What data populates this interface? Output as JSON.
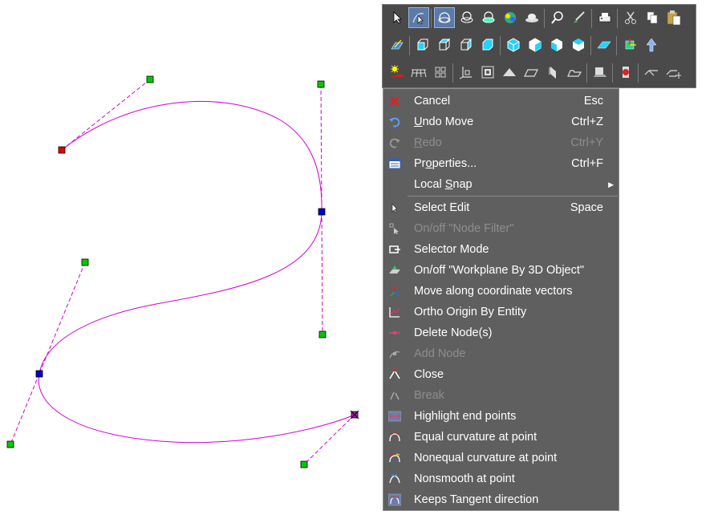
{
  "toolbar": {
    "row1": [
      "select-arrow",
      "edit-node",
      "sphere-tool",
      "cylinder-tool",
      "sphere-alt-tool",
      "color-tool",
      "hat-tool",
      "zoom-search",
      "brush-tool",
      "printer-tool",
      "cut",
      "copy",
      "paste"
    ],
    "row2": [
      "workplane-tool",
      "box-front",
      "box-top",
      "box-side",
      "box-iso",
      "cube-1",
      "cube-2",
      "cube-3",
      "cube-4",
      "plane-tool",
      "coordinate-tool",
      "up-arrow-tool"
    ],
    "row3": [
      "light-tool",
      "grid-tool",
      "small-grid-tool",
      "axis-tool",
      "frame-tool",
      "plane-a",
      "plane-b",
      "book-tool",
      "folder-tool",
      "stamp-tool",
      "red-item-tool",
      "angle-a",
      "angle-b"
    ]
  },
  "menu": {
    "items": [
      {
        "label": "Cancel",
        "shortcut": "Esc",
        "icon": "cancel-icon",
        "disabled": false
      },
      {
        "label": "Undo Move",
        "ul": 0,
        "shortcut": "Ctrl+Z",
        "icon": "undo-icon",
        "disabled": false
      },
      {
        "label": "Redo",
        "ul": 0,
        "shortcut": "Ctrl+Y",
        "icon": "redo-icon",
        "disabled": true
      },
      {
        "label": "Properties...",
        "ul": 2,
        "shortcut": "Ctrl+F",
        "icon": "properties-icon",
        "disabled": false
      },
      {
        "label": "Local Snap",
        "ul": 6,
        "shortcut": "",
        "icon": "",
        "disabled": false,
        "submenu": true
      },
      {
        "label": "Select Edit",
        "shortcut": "Space",
        "icon": "select-edit-icon",
        "disabled": false
      },
      {
        "label": "On/off \"Node Filter\"",
        "shortcut": "",
        "icon": "node-filter-icon",
        "disabled": true
      },
      {
        "label": "Selector Mode",
        "shortcut": "",
        "icon": "selector-mode-icon",
        "disabled": false
      },
      {
        "label": "On/off \"Workplane By 3D Object\"",
        "shortcut": "",
        "icon": "workplane-icon",
        "disabled": false
      },
      {
        "label": "Move along coordinate vectors",
        "shortcut": "",
        "icon": "coordinate-vectors-icon",
        "disabled": false
      },
      {
        "label": "Ortho Origin By Entity",
        "shortcut": "",
        "icon": "ortho-origin-icon",
        "disabled": false
      },
      {
        "label": "Delete Node(s)",
        "shortcut": "",
        "icon": "delete-node-icon",
        "disabled": false
      },
      {
        "label": "Add Node",
        "shortcut": "",
        "icon": "add-node-icon",
        "disabled": true
      },
      {
        "label": "Close",
        "shortcut": "",
        "icon": "close-curve-icon",
        "disabled": false
      },
      {
        "label": "Break",
        "shortcut": "",
        "icon": "break-icon",
        "disabled": true
      },
      {
        "label": "Highlight end points",
        "shortcut": "",
        "icon": "highlight-endpoints-icon",
        "disabled": false
      },
      {
        "label": "Equal curvature at point",
        "shortcut": "",
        "icon": "equal-curvature-icon",
        "disabled": false
      },
      {
        "label": "Nonequal curvature at point",
        "shortcut": "",
        "icon": "nonequal-curvature-icon",
        "disabled": false
      },
      {
        "label": "Nonsmooth at point",
        "shortcut": "",
        "icon": "nonsmooth-icon",
        "disabled": false
      },
      {
        "label": "Keeps Tangent direction",
        "shortcut": "",
        "icon": "tangent-direction-icon",
        "disabled": false
      }
    ]
  },
  "colors": {
    "curve": "#d000d0",
    "handle": "#00c800",
    "node": "#0000d0",
    "start_node": "#e00000",
    "menu_bg": "#5f5f5f",
    "toolbar_bg": "#4a4a4a",
    "accent": "#5b7aa8"
  }
}
